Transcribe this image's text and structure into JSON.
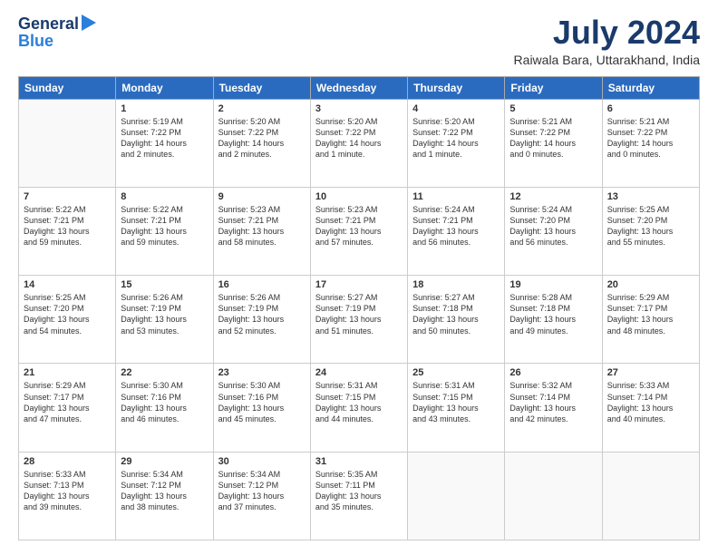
{
  "header": {
    "logo_line1": "General",
    "logo_line2": "Blue",
    "month": "July 2024",
    "location": "Raiwala Bara, Uttarakhand, India"
  },
  "columns": [
    "Sunday",
    "Monday",
    "Tuesday",
    "Wednesday",
    "Thursday",
    "Friday",
    "Saturday"
  ],
  "weeks": [
    [
      {
        "day": "",
        "lines": []
      },
      {
        "day": "1",
        "lines": [
          "Sunrise: 5:19 AM",
          "Sunset: 7:22 PM",
          "Daylight: 14 hours",
          "and 2 minutes."
        ]
      },
      {
        "day": "2",
        "lines": [
          "Sunrise: 5:20 AM",
          "Sunset: 7:22 PM",
          "Daylight: 14 hours",
          "and 2 minutes."
        ]
      },
      {
        "day": "3",
        "lines": [
          "Sunrise: 5:20 AM",
          "Sunset: 7:22 PM",
          "Daylight: 14 hours",
          "and 1 minute."
        ]
      },
      {
        "day": "4",
        "lines": [
          "Sunrise: 5:20 AM",
          "Sunset: 7:22 PM",
          "Daylight: 14 hours",
          "and 1 minute."
        ]
      },
      {
        "day": "5",
        "lines": [
          "Sunrise: 5:21 AM",
          "Sunset: 7:22 PM",
          "Daylight: 14 hours",
          "and 0 minutes."
        ]
      },
      {
        "day": "6",
        "lines": [
          "Sunrise: 5:21 AM",
          "Sunset: 7:22 PM",
          "Daylight: 14 hours",
          "and 0 minutes."
        ]
      }
    ],
    [
      {
        "day": "7",
        "lines": [
          "Sunrise: 5:22 AM",
          "Sunset: 7:21 PM",
          "Daylight: 13 hours",
          "and 59 minutes."
        ]
      },
      {
        "day": "8",
        "lines": [
          "Sunrise: 5:22 AM",
          "Sunset: 7:21 PM",
          "Daylight: 13 hours",
          "and 59 minutes."
        ]
      },
      {
        "day": "9",
        "lines": [
          "Sunrise: 5:23 AM",
          "Sunset: 7:21 PM",
          "Daylight: 13 hours",
          "and 58 minutes."
        ]
      },
      {
        "day": "10",
        "lines": [
          "Sunrise: 5:23 AM",
          "Sunset: 7:21 PM",
          "Daylight: 13 hours",
          "and 57 minutes."
        ]
      },
      {
        "day": "11",
        "lines": [
          "Sunrise: 5:24 AM",
          "Sunset: 7:21 PM",
          "Daylight: 13 hours",
          "and 56 minutes."
        ]
      },
      {
        "day": "12",
        "lines": [
          "Sunrise: 5:24 AM",
          "Sunset: 7:20 PM",
          "Daylight: 13 hours",
          "and 56 minutes."
        ]
      },
      {
        "day": "13",
        "lines": [
          "Sunrise: 5:25 AM",
          "Sunset: 7:20 PM",
          "Daylight: 13 hours",
          "and 55 minutes."
        ]
      }
    ],
    [
      {
        "day": "14",
        "lines": [
          "Sunrise: 5:25 AM",
          "Sunset: 7:20 PM",
          "Daylight: 13 hours",
          "and 54 minutes."
        ]
      },
      {
        "day": "15",
        "lines": [
          "Sunrise: 5:26 AM",
          "Sunset: 7:19 PM",
          "Daylight: 13 hours",
          "and 53 minutes."
        ]
      },
      {
        "day": "16",
        "lines": [
          "Sunrise: 5:26 AM",
          "Sunset: 7:19 PM",
          "Daylight: 13 hours",
          "and 52 minutes."
        ]
      },
      {
        "day": "17",
        "lines": [
          "Sunrise: 5:27 AM",
          "Sunset: 7:19 PM",
          "Daylight: 13 hours",
          "and 51 minutes."
        ]
      },
      {
        "day": "18",
        "lines": [
          "Sunrise: 5:27 AM",
          "Sunset: 7:18 PM",
          "Daylight: 13 hours",
          "and 50 minutes."
        ]
      },
      {
        "day": "19",
        "lines": [
          "Sunrise: 5:28 AM",
          "Sunset: 7:18 PM",
          "Daylight: 13 hours",
          "and 49 minutes."
        ]
      },
      {
        "day": "20",
        "lines": [
          "Sunrise: 5:29 AM",
          "Sunset: 7:17 PM",
          "Daylight: 13 hours",
          "and 48 minutes."
        ]
      }
    ],
    [
      {
        "day": "21",
        "lines": [
          "Sunrise: 5:29 AM",
          "Sunset: 7:17 PM",
          "Daylight: 13 hours",
          "and 47 minutes."
        ]
      },
      {
        "day": "22",
        "lines": [
          "Sunrise: 5:30 AM",
          "Sunset: 7:16 PM",
          "Daylight: 13 hours",
          "and 46 minutes."
        ]
      },
      {
        "day": "23",
        "lines": [
          "Sunrise: 5:30 AM",
          "Sunset: 7:16 PM",
          "Daylight: 13 hours",
          "and 45 minutes."
        ]
      },
      {
        "day": "24",
        "lines": [
          "Sunrise: 5:31 AM",
          "Sunset: 7:15 PM",
          "Daylight: 13 hours",
          "and 44 minutes."
        ]
      },
      {
        "day": "25",
        "lines": [
          "Sunrise: 5:31 AM",
          "Sunset: 7:15 PM",
          "Daylight: 13 hours",
          "and 43 minutes."
        ]
      },
      {
        "day": "26",
        "lines": [
          "Sunrise: 5:32 AM",
          "Sunset: 7:14 PM",
          "Daylight: 13 hours",
          "and 42 minutes."
        ]
      },
      {
        "day": "27",
        "lines": [
          "Sunrise: 5:33 AM",
          "Sunset: 7:14 PM",
          "Daylight: 13 hours",
          "and 40 minutes."
        ]
      }
    ],
    [
      {
        "day": "28",
        "lines": [
          "Sunrise: 5:33 AM",
          "Sunset: 7:13 PM",
          "Daylight: 13 hours",
          "and 39 minutes."
        ]
      },
      {
        "day": "29",
        "lines": [
          "Sunrise: 5:34 AM",
          "Sunset: 7:12 PM",
          "Daylight: 13 hours",
          "and 38 minutes."
        ]
      },
      {
        "day": "30",
        "lines": [
          "Sunrise: 5:34 AM",
          "Sunset: 7:12 PM",
          "Daylight: 13 hours",
          "and 37 minutes."
        ]
      },
      {
        "day": "31",
        "lines": [
          "Sunrise: 5:35 AM",
          "Sunset: 7:11 PM",
          "Daylight: 13 hours",
          "and 35 minutes."
        ]
      },
      {
        "day": "",
        "lines": []
      },
      {
        "day": "",
        "lines": []
      },
      {
        "day": "",
        "lines": []
      }
    ]
  ]
}
